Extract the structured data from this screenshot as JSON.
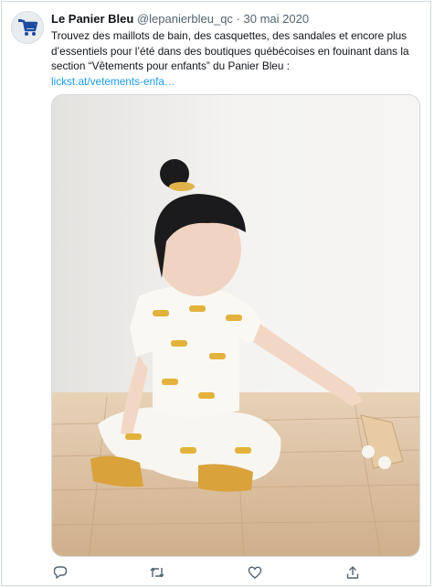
{
  "tweet": {
    "author_name": "Le Panier Bleu",
    "handle": "@lepanierbleu_qc",
    "separator": "·",
    "date": "30 mai 2020",
    "text": "Trouvez des maillots de bain, des casquettes, des sandales et encore plus d’essentiels pour l’été dans des boutiques québécoises en fouinant dans la section “Vêtements pour enfants” du Panier Bleu :",
    "link": "lickst.at/vetements-enfa…"
  },
  "icons": {
    "avatar": "shopping-cart-logo",
    "reply": "reply-icon",
    "retweet": "retweet-icon",
    "like": "heart-icon",
    "share": "share-icon"
  },
  "colors": {
    "link": "#1d9bf0",
    "brand_blue": "#1b4ba0",
    "text_secondary": "#536471",
    "border": "#cfd9de"
  }
}
